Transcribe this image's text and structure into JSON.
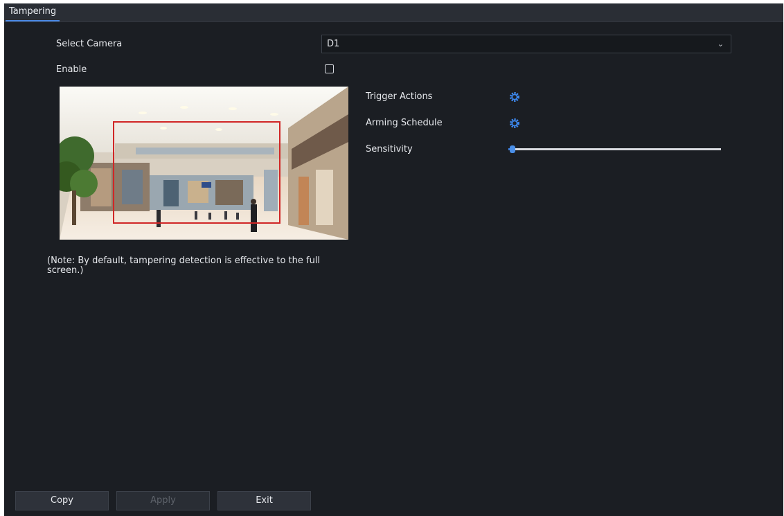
{
  "tabs": [
    {
      "label": "Tampering"
    }
  ],
  "form": {
    "select_camera_label": "Select Camera",
    "select_camera_value": "D1",
    "enable_label": "Enable",
    "enable_checked": false,
    "trigger_actions_label": "Trigger Actions",
    "arming_schedule_label": "Arming Schedule",
    "sensitivity_label": "Sensitivity",
    "sensitivity_value": 0.02
  },
  "note": "(Note: By default, tampering detection is effective to the full screen.)",
  "icons": {
    "trigger_actions": "gear-icon",
    "arming_schedule": "gear-icon",
    "dropdown": "chevron-down-icon"
  },
  "colors": {
    "background": "#1b1e23",
    "accent": "#4a89e6",
    "detection_area": "#d02626"
  },
  "buttons": {
    "copy": "Copy",
    "apply": "Apply",
    "exit": "Exit"
  }
}
